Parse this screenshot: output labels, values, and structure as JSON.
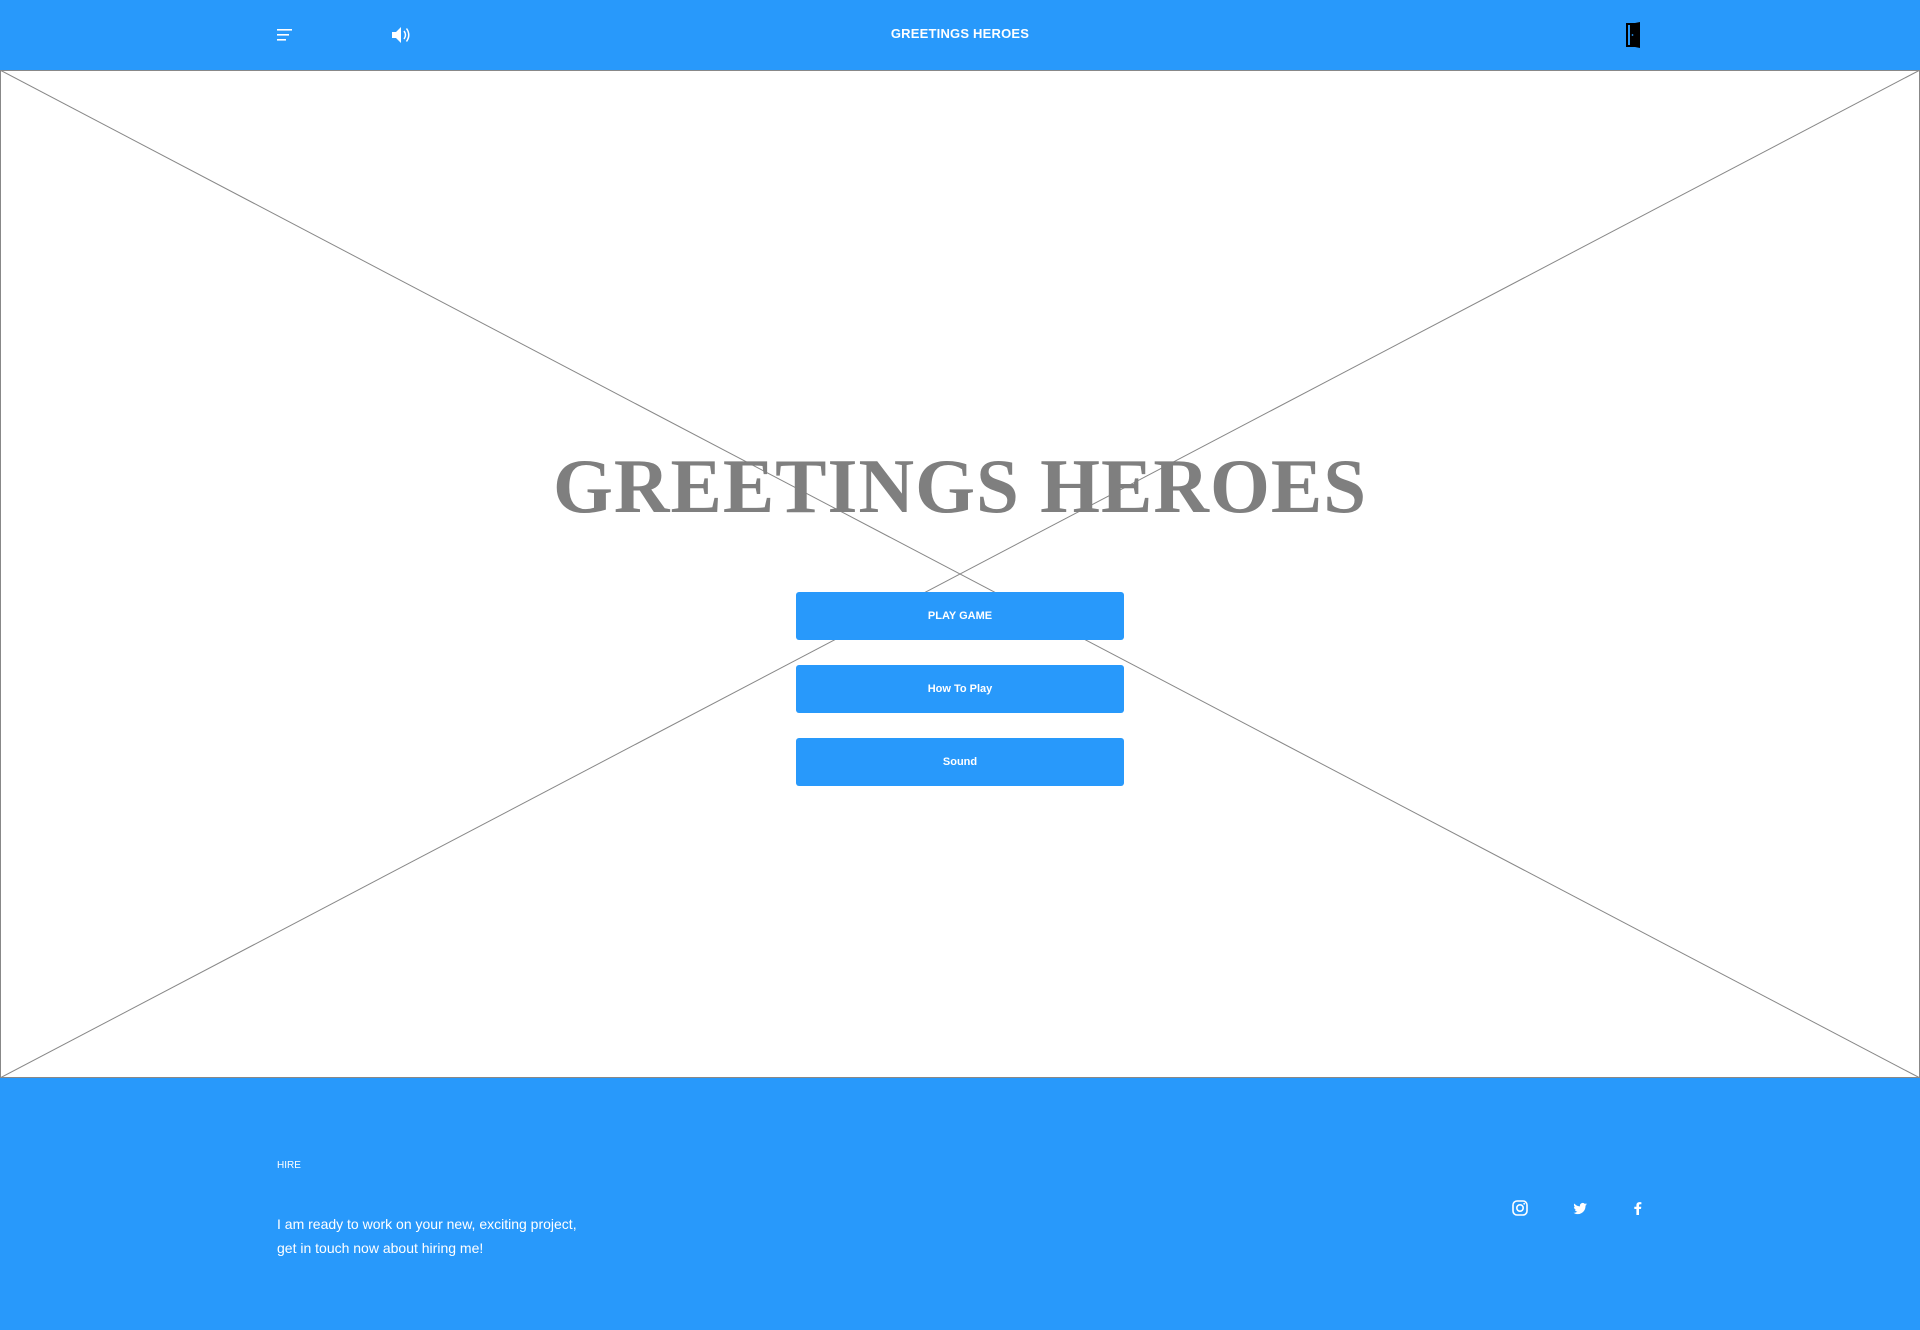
{
  "header": {
    "title": "GREETINGS HEROES",
    "menu_icon": "hamburger-menu-icon",
    "sound_icon": "speaker-volume-icon",
    "exit_icon": "exit-door-icon"
  },
  "hero": {
    "title": "GREETINGS HEROES",
    "buttons": [
      {
        "label": "PLAY GAME"
      },
      {
        "label": "How To Play"
      },
      {
        "label": "Sound"
      }
    ]
  },
  "footer": {
    "hire_label": "HIRE",
    "hire_text_lines": [
      "I am ready to work on your new, exciting project,",
      "get in touch now about hiring me!"
    ],
    "social": [
      {
        "icon": "instagram-icon"
      },
      {
        "icon": "twitter-icon"
      },
      {
        "icon": "facebook-icon"
      }
    ]
  },
  "colors": {
    "accent": "#2899fb",
    "title_gray": "#7f7f7f",
    "background": "#ffffff"
  }
}
